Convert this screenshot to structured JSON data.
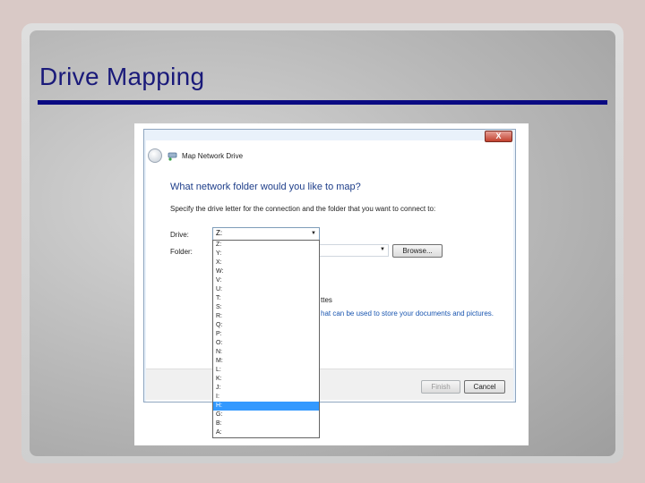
{
  "slide": {
    "title": "Drive Mapping"
  },
  "window": {
    "title": "Map Network Drive",
    "close_glyph": "X",
    "question": "What network folder would you like to map?",
    "instruction": "Specify the drive letter for the connection and the folder that you want to connect to:",
    "drive_label": "Drive:",
    "drive_value": "Z:",
    "folder_label": "Folder:",
    "browse_label": "Browse...",
    "partial_text_1": "ttes",
    "partial_link": "hat can be used to store your documents and pictures.",
    "finish_label": "Finish",
    "cancel_label": "Cancel"
  },
  "drive_list": {
    "items": [
      "Z:",
      "Y:",
      "X:",
      "W:",
      "V:",
      "U:",
      "T:",
      "S:",
      "R:",
      "Q:",
      "P:",
      "O:",
      "N:",
      "M:",
      "L:",
      "K:",
      "J:",
      "I:",
      "H:",
      "G:",
      "B:",
      "A:"
    ],
    "selected_index": 18
  }
}
